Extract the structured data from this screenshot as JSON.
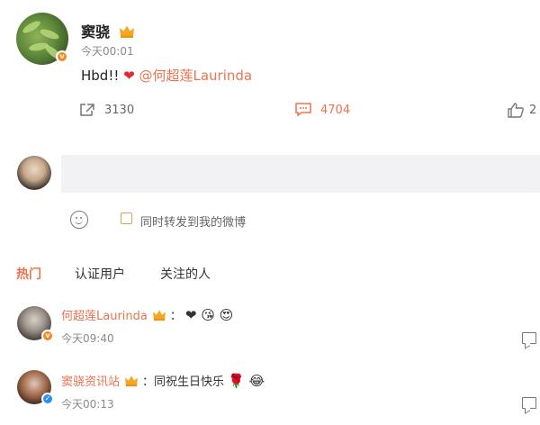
{
  "post": {
    "username": "窦骁",
    "timestamp": "今天00:01",
    "text": "Hbd!! ",
    "heart": "❤",
    "mention": "@何超莲Laurinda",
    "repost_count": "3130",
    "comment_count": "4704",
    "like_count_partial": "2"
  },
  "reply_box": {
    "placeholder": "",
    "repost_option": "同时转发到我的微博"
  },
  "tabs": [
    "热门",
    "认证用户",
    "关注的人"
  ],
  "comments": [
    {
      "name": "何超莲Laurinda",
      "text": "：",
      "emojis": "❤ 😘 😍",
      "time": "今天09:40"
    },
    {
      "name": "窦骁资讯站",
      "text": "：同祝生日快乐",
      "emojis": "🌹 😂",
      "time": "今天00:13"
    }
  ],
  "colors": {
    "accent": "#eb7350",
    "input_bg": "#f2f2f5"
  }
}
